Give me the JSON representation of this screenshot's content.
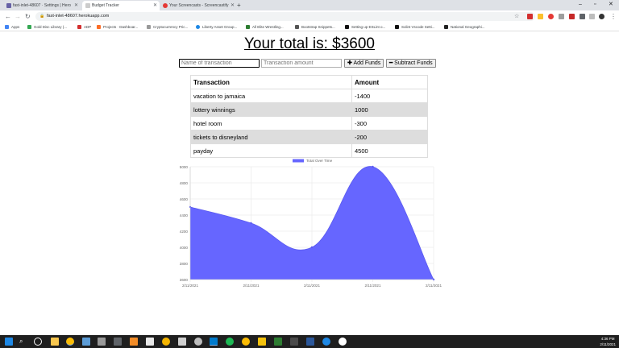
{
  "browser": {
    "tabs": [
      {
        "title": "fast-inlet-48607 · Settings | Hero",
        "icon_color": "#6762a6",
        "active": false
      },
      {
        "title": "Budget Tracker",
        "icon_color": "#cccccc",
        "active": true
      },
      {
        "title": "Your Screencasts - Screencastify",
        "icon_color": "#e53935",
        "active": false
      }
    ],
    "url": "fast-inlet-48607.herokuapp.com",
    "bookmarks": [
      {
        "label": "Apps",
        "color": "#4285f4"
      },
      {
        "label": "Gold Disc Library (...",
        "color": "#34a853"
      },
      {
        "label": "ADP",
        "color": "#d32f2f"
      },
      {
        "label": "Projects · Dashboar...",
        "color": "#fc6d26"
      },
      {
        "label": "Cryptocurrency Pric...",
        "color": "#999999"
      },
      {
        "label": "Liberty Asset Group...",
        "color": "#1e88e5"
      },
      {
        "label": "All Elite Wrestling...",
        "color": "#2e7d32"
      },
      {
        "label": "Bootstrap Snippets...",
        "color": "#555555"
      },
      {
        "label": "Setting up ESLint o...",
        "color": "#111111"
      },
      {
        "label": "Solint Vscode Setti...",
        "color": "#111111"
      },
      {
        "label": "National Geographi...",
        "color": "#222222"
      }
    ]
  },
  "app": {
    "total_label": "Your total is: $3600",
    "name_placeholder": "Name of transaction",
    "amount_placeholder": "Transaction amount",
    "add_icon": "plus-icon",
    "add_label": "Add Funds",
    "subtract_icon": "minus-icon",
    "subtract_label": "Subtract Funds",
    "table": {
      "headers": [
        "Transaction",
        "Amount"
      ],
      "rows": [
        [
          "vacation to jamaica",
          "-1400"
        ],
        [
          "lottery winnings",
          "1000"
        ],
        [
          "hotel room",
          "-300"
        ],
        [
          "tickets to disneyland",
          "-200"
        ],
        [
          "payday",
          "4500"
        ]
      ]
    }
  },
  "chart_data": {
    "type": "area",
    "x": [
      "2/11/2021",
      "2/11/2021",
      "2/11/2021",
      "2/11/2021",
      "2/11/2021"
    ],
    "series": [
      {
        "name": "Total Over Time",
        "values": [
          4500,
          4300,
          4000,
          5000,
          3600
        ],
        "color": "#6666ff"
      }
    ],
    "yticks": [
      5000,
      4800,
      4600,
      4400,
      4200,
      4000,
      3800,
      3600
    ],
    "ylim": [
      3600,
      5000
    ],
    "legend": "top"
  },
  "taskbar": {
    "time": "4:36 PM",
    "date": "2/11/2021"
  }
}
